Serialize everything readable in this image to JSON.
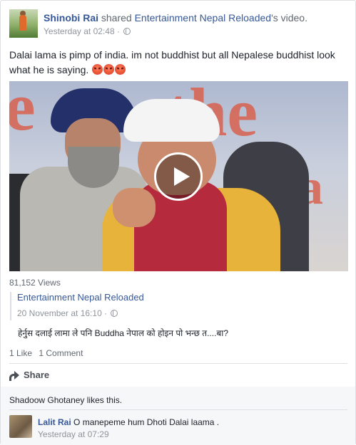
{
  "post": {
    "author": "Shinobi Rai",
    "action": "shared",
    "shared_page": "Entertainment Nepal Reloaded",
    "suffix": "'s video.",
    "time": "Yesterday at 02:48",
    "separator": "·",
    "caption": "Dalai lama is pimp of india. im not buddhist but all Nepalese buddhist look what he is saying.",
    "caption_emoji": [
      "angry-face-emoji",
      "angry-face-emoji",
      "angry-face-emoji"
    ]
  },
  "video": {
    "views": "81,152 Views",
    "play_icon": "play-icon"
  },
  "shared_source": {
    "page": "Entertainment Nepal Reloaded",
    "time": "20 November at 16:10",
    "separator": "·",
    "text": "हेर्नुस दलाई लामा ले पनि Buddha नेपाल को होइन पो भन्छ त....बा?"
  },
  "counts": {
    "likes": "1 Like",
    "comments": "1 Comment"
  },
  "actions": {
    "share_label": "Share",
    "share_icon": "share-icon"
  },
  "footer": {
    "likes_text": "Shadoow Ghotaney likes this."
  },
  "comment": {
    "author": "Lalit Rai",
    "text": "O manepeme hum Dhoti Dalai laama .",
    "time": "Yesterday at 07:29"
  },
  "colors": {
    "link": "#365899",
    "meta": "#90949c",
    "border": "#dddfe2",
    "footer_bg": "#f6f7f9"
  }
}
